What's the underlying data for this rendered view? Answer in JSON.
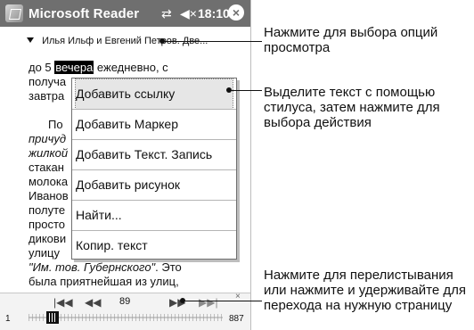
{
  "titlebar": {
    "app_title": "Microsoft Reader",
    "connectivity_icon": "⇄",
    "volume_icon": "◀×",
    "time": "18:10",
    "close_icon": "×"
  },
  "book": {
    "title_line": "Илья Ильф и Евгений Петров. Две..."
  },
  "content": {
    "lines": [
      {
        "pre": "до 5 ",
        "sel": "вечера",
        "post": " ежедневно, с"
      },
      {
        "text": "получа"
      },
      {
        "text": "завтра"
      },
      {
        "text": "По"
      },
      {
        "text": "причуд",
        "italic": true
      },
      {
        "text": "жилкой",
        "italic": true
      },
      {
        "text": "стакан"
      },
      {
        "text": "молока"
      },
      {
        "text": "Иванов"
      },
      {
        "text": "полуте"
      },
      {
        "text": "просто"
      },
      {
        "text": "дикови"
      },
      {
        "text": "улицу"
      },
      {
        "pre_italic": "\"Им. тов. Губернского\"",
        "post": ". Это"
      },
      {
        "text": "была приятнейшая из улиц,"
      }
    ]
  },
  "context_menu": {
    "items": [
      {
        "label": "Добавить ссылку"
      },
      {
        "label": "Добавить Маркер"
      },
      {
        "label": "Добавить Текст. Запись"
      },
      {
        "label": "Добавить рисунок"
      },
      {
        "label": "Найти..."
      },
      {
        "label": "Копир. текст"
      }
    ]
  },
  "navigation": {
    "first_icon": "|◀◀",
    "prev_icon": "◀◀",
    "page_number": "89",
    "next_icon": "▶▶",
    "last_icon": "▶▶|",
    "small_close": "×",
    "left_page": "1",
    "right_page": "887",
    "progress_fraction": 0.1
  },
  "callouts": {
    "view_options": "Нажмите для выбора опций просмотра",
    "selection_action": "Выделите текст с помощью стилуса, затем нажмите для выбора действия",
    "paging": "Нажмите для перелистывания или нажмите и удерживайте для перехода на нужную страницу"
  }
}
